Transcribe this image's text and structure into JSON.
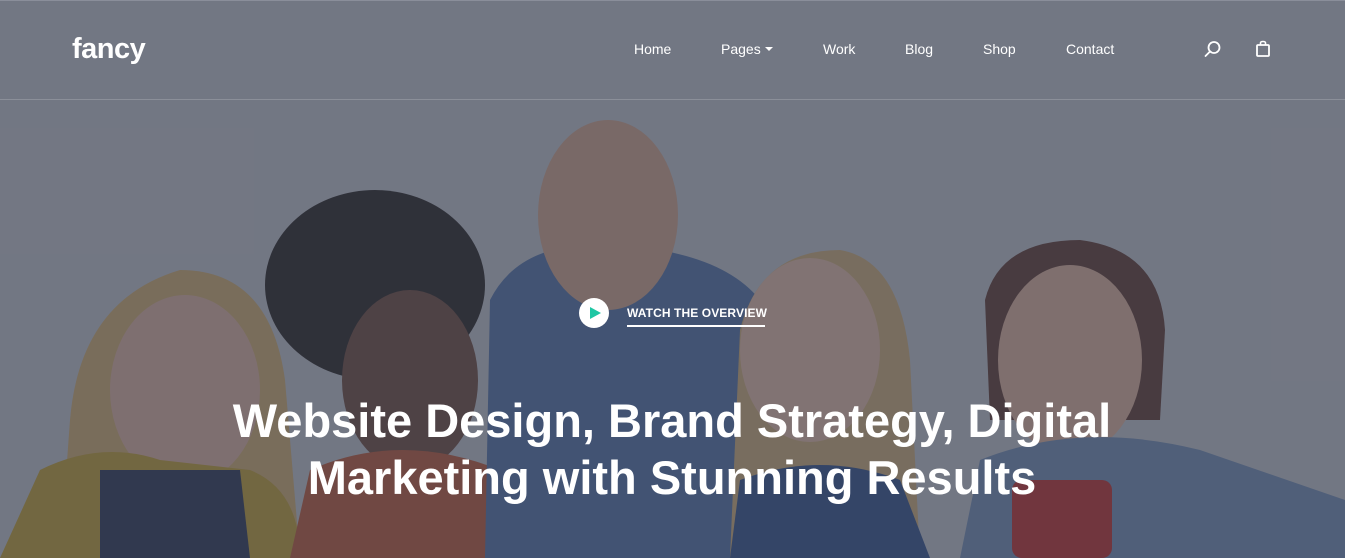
{
  "brand": {
    "logo_text": "fancy"
  },
  "nav": {
    "items": [
      {
        "label": "Home"
      },
      {
        "label": "Pages",
        "has_dropdown": true
      },
      {
        "label": "Work"
      },
      {
        "label": "Blog"
      },
      {
        "label": "Shop"
      },
      {
        "label": "Contact"
      }
    ],
    "icons": [
      "search-icon",
      "shopping-bag-icon"
    ]
  },
  "hero": {
    "watch_label": "WATCH THE OVERVIEW",
    "headline_line1": "Website Design, Brand Strategy, Digital",
    "headline_line2": "Marketing with Stunning Results"
  },
  "colors": {
    "overlay": "#3e4252",
    "accent": "#1fc7a4",
    "text": "#ffffff"
  }
}
